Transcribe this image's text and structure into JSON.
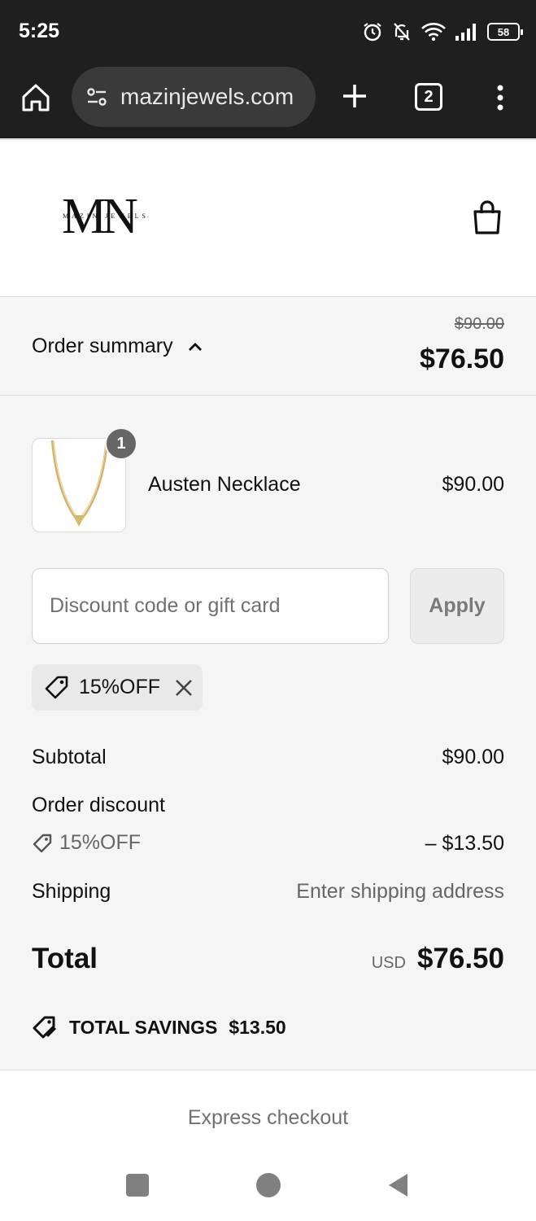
{
  "status_bar": {
    "time": "5:25",
    "battery": "58",
    "icons": [
      "alarm-icon",
      "bell-off-icon",
      "wifi-icon",
      "signal-icon",
      "battery-icon"
    ]
  },
  "browser": {
    "url": "mazinjewels.com",
    "tab_count": "2"
  },
  "header": {
    "logo_letters": "MN",
    "logo_text": "MAZIN JEWELS"
  },
  "summary": {
    "toggle_label": "Order summary",
    "original_total": "$90.00",
    "total": "$76.50"
  },
  "line_item": {
    "quantity": "1",
    "name": "Austen Necklace",
    "price": "$90.00"
  },
  "discount": {
    "placeholder": "Discount code or gift card",
    "apply_label": "Apply",
    "applied_code": "15%OFF"
  },
  "totals": {
    "subtotal_label": "Subtotal",
    "subtotal_value": "$90.00",
    "order_discount_label": "Order discount",
    "discount_code": "15%OFF",
    "discount_value": "– $13.50",
    "shipping_label": "Shipping",
    "shipping_value": "Enter shipping address",
    "total_label": "Total",
    "currency": "USD",
    "total_value": "$76.50",
    "savings_label": "TOTAL SAVINGS",
    "savings_value": "$13.50"
  },
  "express": {
    "label": "Express checkout"
  },
  "colors": {
    "background": "#f5f5f5",
    "chrome": "#1f1f1f",
    "text": "#111111",
    "muted": "#666666"
  }
}
